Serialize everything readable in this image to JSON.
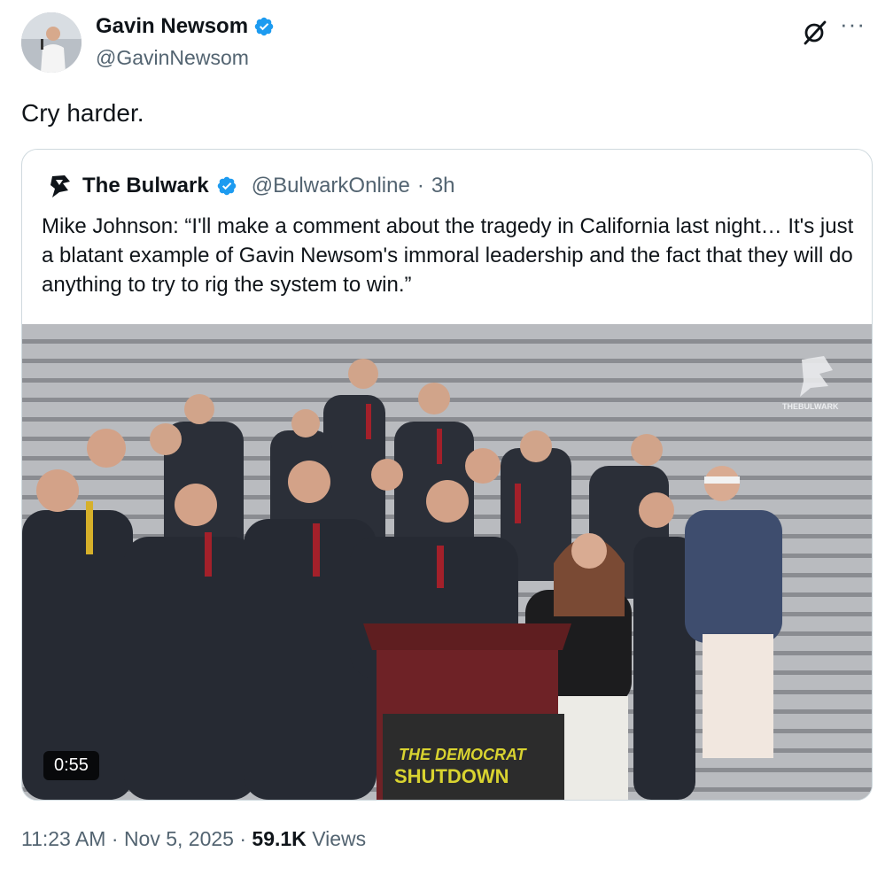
{
  "author": {
    "name": "Gavin Newsom",
    "handle": "@GavinNewsom"
  },
  "tweet": {
    "text": "Cry harder."
  },
  "quote": {
    "author_name": "The Bulwark",
    "author_handle": "@BulwarkOnline",
    "time": "3h",
    "text": "Mike Johnson: “I'll make a comment about the tragedy in California last night… It's just a blatant example of Gavin Newsom's immoral leadership and the fact that they will do anything to try to rig the system to win.”",
    "video": {
      "duration": "0:55",
      "podium_sign_line1": "THE DEMOCRAT",
      "podium_sign_line2": "SHUTDOWN",
      "watermark": "THEBULWARK"
    }
  },
  "meta": {
    "time": "11:23 AM",
    "date": "Nov 5, 2025",
    "views_count": "59.1K",
    "views_label": "Views"
  },
  "icons": {
    "verified": "verified-badge-icon",
    "grok": "grok-icon",
    "more": "more-icon"
  },
  "colors": {
    "verified": "#1d9bf0",
    "secondary_text": "#536471",
    "border": "#cfd9de"
  }
}
